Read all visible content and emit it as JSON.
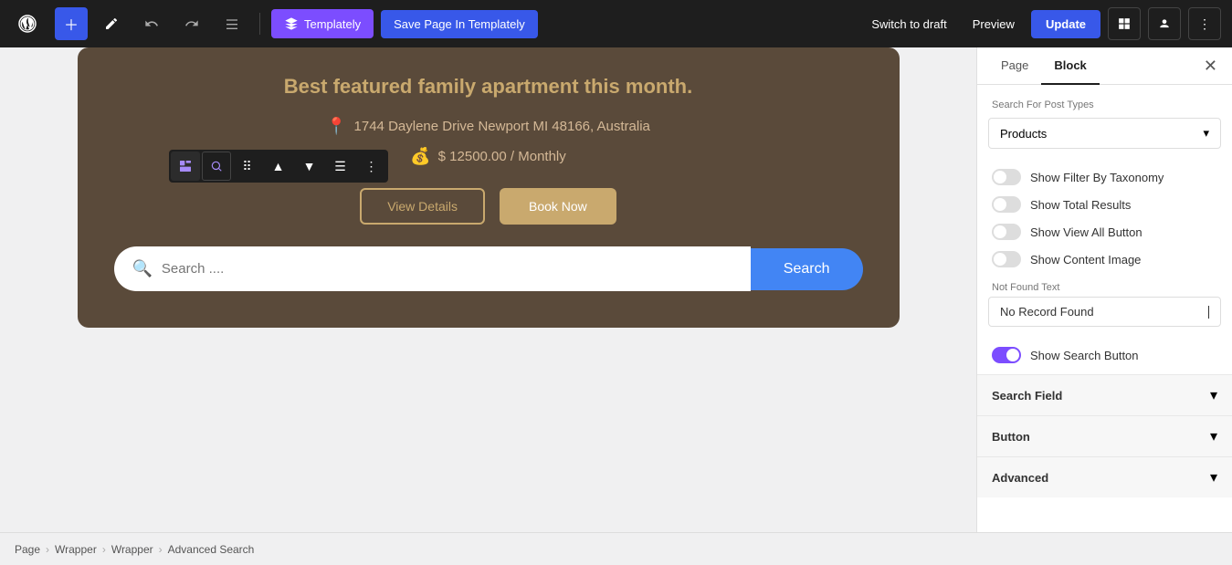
{
  "toolbar": {
    "plus_label": "+",
    "templately_label": "Templately",
    "save_templately_label": "Save Page In Templately",
    "switch_draft_label": "Switch to draft",
    "preview_label": "Preview",
    "update_label": "Update"
  },
  "hero": {
    "title": "Best featured family apartment this month.",
    "address": "1744 Daylene Drive Newport MI 48166, Australia",
    "price": "$ 12500.00 / Monthly",
    "view_details_label": "View Details",
    "book_now_label": "Book Now",
    "search_placeholder": "Search ....",
    "search_button_label": "Search"
  },
  "breadcrumb": {
    "items": [
      "Page",
      "Wrapper",
      "Wrapper",
      "Advanced Search"
    ]
  },
  "panel": {
    "tab_page": "Page",
    "tab_block": "Block",
    "search_for_post_types_label": "Search For Post Types",
    "dropdown_value": "Products",
    "toggle_filter_taxonomy_label": "Show Filter By Taxonomy",
    "toggle_total_results_label": "Show Total Results",
    "toggle_view_all_label": "Show View All Button",
    "toggle_content_image_label": "Show Content Image",
    "not_found_text_label": "Not Found Text",
    "not_found_value": "No Record Found",
    "show_search_button_label": "Show Search Button",
    "section_search_field": "Search Field",
    "section_button": "Button",
    "section_advanced": "Advanced"
  }
}
